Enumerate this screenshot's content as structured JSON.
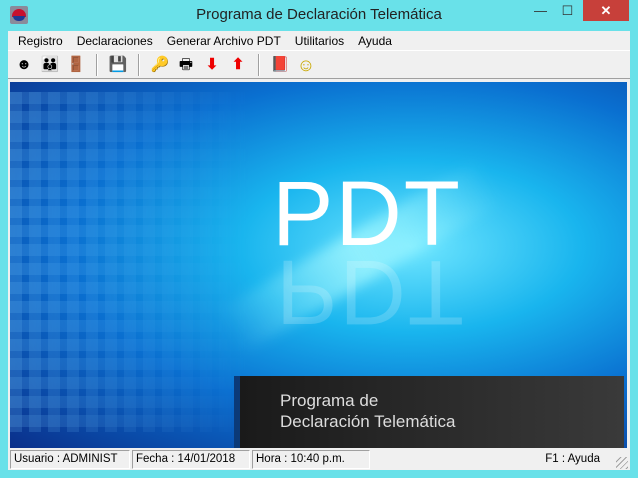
{
  "window": {
    "title": "Programa de Declaración Telemática",
    "min": "—",
    "max": "☐",
    "close": "✕"
  },
  "menu": [
    "Registro",
    "Declaraciones",
    "Generar Archivo PDT",
    "Utilitarios",
    "Ayuda"
  ],
  "toolbar": [
    {
      "icon": "user-icon",
      "glyph": "☻"
    },
    {
      "icon": "users-icon",
      "glyph": "👪"
    },
    {
      "icon": "exit-door-icon",
      "glyph": "🚪"
    },
    {
      "icon": "save-disk-icon",
      "glyph": "💾"
    },
    {
      "icon": "key-icon",
      "glyph": "🔑"
    },
    {
      "icon": "printer-icon",
      "glyph": "🖶"
    },
    {
      "icon": "disk-download-icon",
      "glyph": "⬇"
    },
    {
      "icon": "disk-upload-icon",
      "glyph": "⬆"
    },
    {
      "icon": "help-book-icon",
      "glyph": "📕"
    },
    {
      "icon": "smiley-icon",
      "glyph": "☺"
    }
  ],
  "hero": {
    "title": "PDT",
    "banner_line1": "Programa de",
    "banner_line2": "Declaración Telemática"
  },
  "status": {
    "user": "Usuario : ADMINIST",
    "date": "Fecha : 14/01/2018",
    "time": "Hora : 10:40 p.m.",
    "help": "F1 : Ayuda"
  }
}
